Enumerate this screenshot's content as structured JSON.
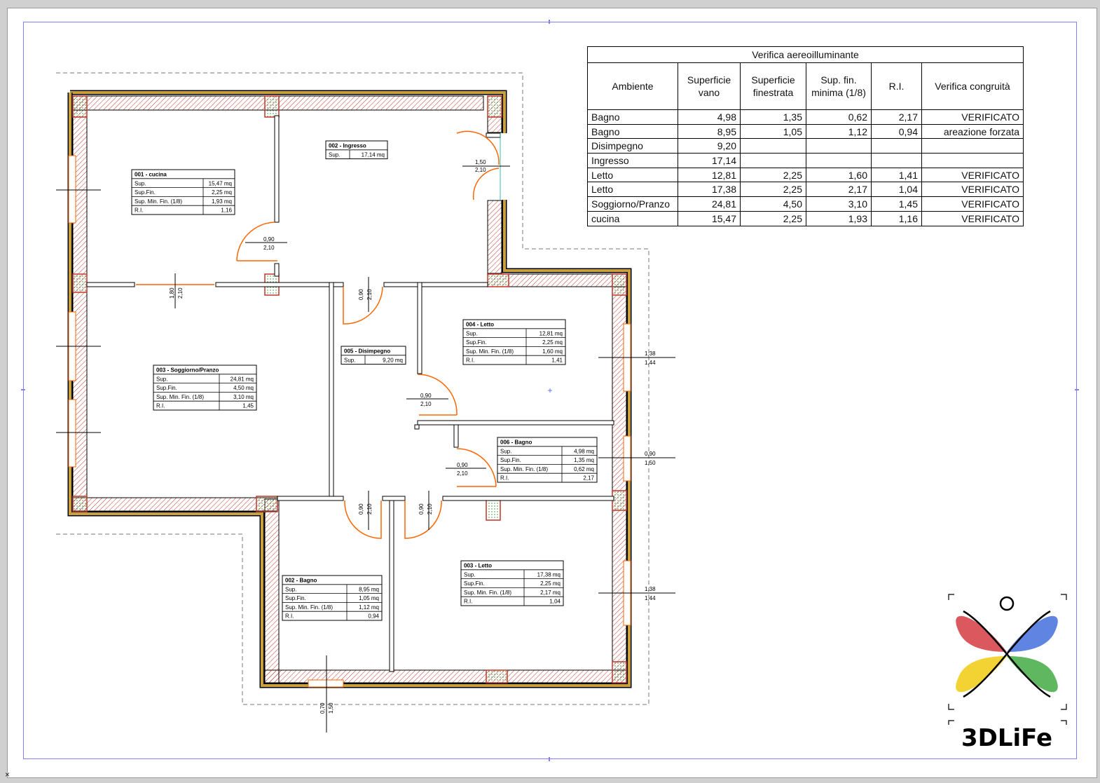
{
  "rooms": [
    {
      "title": "001 - cucina",
      "sup_label": "Sup.",
      "sup": "15,47 mq",
      "supfin_label": "Sup.Fin.",
      "supfin": "2,25 mq",
      "supmin_label": "Sup. Min. Fin. (1/8)",
      "supmin": "1,93 mq",
      "ri_label": "R.I.",
      "ri": "1,16"
    },
    {
      "title": "002 - Ingresso",
      "sup_label": "Sup.",
      "sup": "17,14 mq"
    },
    {
      "title": "003 - Soggiorno/Pranzo",
      "sup_label": "Sup.",
      "sup": "24,81 mq",
      "supfin_label": "Sup.Fin.",
      "supfin": "4,50 mq",
      "supmin_label": "Sup. Min. Fin. (1/8)",
      "supmin": "3,10 mq",
      "ri_label": "R.I.",
      "ri": "1,45"
    },
    {
      "title": "004 - Letto",
      "sup_label": "Sup.",
      "sup": "12,81 mq",
      "supfin_label": "Sup.Fin.",
      "supfin": "2,25 mq",
      "supmin_label": "Sup. Min. Fin. (1/8)",
      "supmin": "1,60 mq",
      "ri_label": "R.I.",
      "ri": "1,41"
    },
    {
      "title": "005 - Disimpegno",
      "sup_label": "Sup.",
      "sup": "9,20 mq"
    },
    {
      "title": "006 - Bagno",
      "sup_label": "Sup.",
      "sup": "4,98 mq",
      "supfin_label": "Sup.Fin.",
      "supfin": "1,35 mq",
      "supmin_label": "Sup. Min. Fin. (1/8)",
      "supmin": "0,62 mq",
      "ri_label": "R.I.",
      "ri": "2,17"
    },
    {
      "title": "002 - Bagno",
      "sup_label": "Sup.",
      "sup": "8,95 mq",
      "supfin_label": "Sup.Fin.",
      "supfin": "1,05 mq",
      "supmin_label": "Sup. Min. Fin. (1/8)",
      "supmin": "1,12 mq",
      "ri_label": "R.I.",
      "ri": "0,94"
    },
    {
      "title": "003 - Letto",
      "sup_label": "Sup.",
      "sup": "17,38 mq",
      "supfin_label": "Sup.Fin.",
      "supfin": "2,25 mq",
      "supmin_label": "Sup. Min. Fin. (1/8)",
      "supmin": "2,17 mq",
      "ri_label": "R.I.",
      "ri": "1,04"
    }
  ],
  "dims": {
    "d1_top": "0,90",
    "d1_bot": "2,10",
    "d2_top": "1,50",
    "d2_bot": "2,10",
    "d3_a": "1,80",
    "d3_b": "2,10",
    "d4_a": "0,90",
    "d4_b": "2,10",
    "d5_top": "0,90",
    "d5_bot": "2,10",
    "d6_top": "0,90",
    "d6_bot": "2,10",
    "d7_a": "0,90",
    "d7_b": "2,10",
    "d8_a": "0,90",
    "d8_b": "2,10",
    "d9_a": "0,70",
    "d9_b": "1,50",
    "w1_top": "1,38",
    "w1_bot": "1,44",
    "w2_top": "0,90",
    "w2_bot": "1,50",
    "w3_top": "1,38",
    "w3_bot": "1,44"
  },
  "verifica": {
    "title": "Verifica aereoilluminante",
    "headers": [
      "Ambiente",
      "Superficie vano",
      "Superficie finestrata",
      "Sup. fin. minima (1/8)",
      "R.I.",
      "Verifica congruità"
    ],
    "rows": [
      [
        "Bagno",
        "4,98",
        "1,35",
        "0,62",
        "2,17",
        "VERIFICATO"
      ],
      [
        "Bagno",
        "8,95",
        "1,05",
        "1,12",
        "0,94",
        "areazione forzata"
      ],
      [
        "Disimpegno",
        "9,20",
        "",
        "",
        "",
        ""
      ],
      [
        "Ingresso",
        "17,14",
        "",
        "",
        "",
        ""
      ],
      [
        "Letto",
        "12,81",
        "2,25",
        "1,60",
        "1,41",
        "VERIFICATO"
      ],
      [
        "Letto",
        "17,38",
        "2,25",
        "2,17",
        "1,04",
        "VERIFICATO"
      ],
      [
        "Soggiorno/Pranzo",
        "24,81",
        "4,50",
        "3,10",
        "1,45",
        "VERIFICATO"
      ],
      [
        "cucina",
        "15,47",
        "2,25",
        "1,93",
        "1,16",
        "VERIFICATO"
      ]
    ]
  },
  "logo": {
    "text": "3DLiFe"
  },
  "close_glyph": "×",
  "colors": {
    "wall": "#000000",
    "hatch": "#c0392b",
    "frame": "#8080ff",
    "door": "#ff6600",
    "logo_red": "#d0202a",
    "logo_blue": "#2a5bd7",
    "logo_green": "#2aa02a",
    "logo_yellow": "#f0c800"
  }
}
